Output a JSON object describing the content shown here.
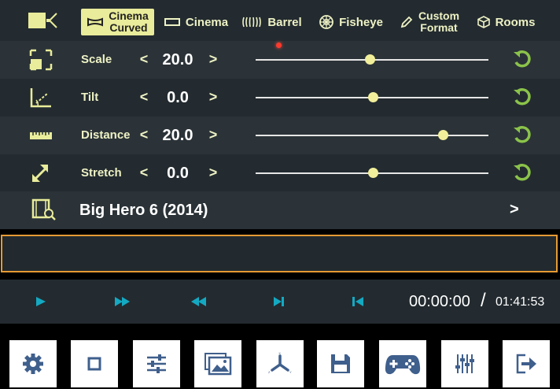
{
  "colors": {
    "accent_yellow": "#e9ec9a",
    "panel_dark": "#232b30",
    "panel_light": "#2b3338",
    "cyan": "#14a9c2",
    "green": "#8bc34a",
    "orange": "#e79a34",
    "bottom_icon": "#3f5f8c"
  },
  "modes": [
    {
      "label_line1": "Cinema",
      "label_line2": "Curved",
      "icon": "curved-screen-icon",
      "active": true
    },
    {
      "label": "Cinema",
      "icon": "flat-screen-icon",
      "active": false
    },
    {
      "label": "Barrel",
      "icon": "barrel-icon",
      "active": false
    },
    {
      "label": "Fisheye",
      "icon": "fisheye-icon",
      "active": false
    },
    {
      "label_line1": "Custom",
      "label_line2": "Format",
      "icon": "pencil-icon",
      "active": false
    },
    {
      "label": "Rooms",
      "icon": "cube-icon",
      "active": false
    }
  ],
  "controls": [
    {
      "label": "Scale",
      "value": "20.0",
      "icon": "scale-icon",
      "slider_fraction": 0.49
    },
    {
      "label": "Tilt",
      "value": "0.0",
      "icon": "tilt-icon",
      "slider_fraction": 0.505
    },
    {
      "label": "Distance",
      "value": "20.0",
      "icon": "ruler-icon",
      "slider_fraction": 0.805
    },
    {
      "label": "Stretch",
      "value": "0.0",
      "icon": "stretch-icon",
      "slider_fraction": 0.505
    }
  ],
  "arrows": {
    "left": "<",
    "right": ">"
  },
  "movie": {
    "title": "Big Hero 6 (2014)",
    "chevron": ">"
  },
  "input": {
    "value": ""
  },
  "transport": {
    "current_time": "00:00:00",
    "separator": "/",
    "total_time": "01:41:53"
  },
  "bottom_buttons": [
    "gear-icon",
    "stop-icon",
    "sliders-icon",
    "gallery-icon",
    "axes-icon",
    "save-icon",
    "gamepad-icon",
    "equalizer-icon",
    "exit-icon"
  ]
}
